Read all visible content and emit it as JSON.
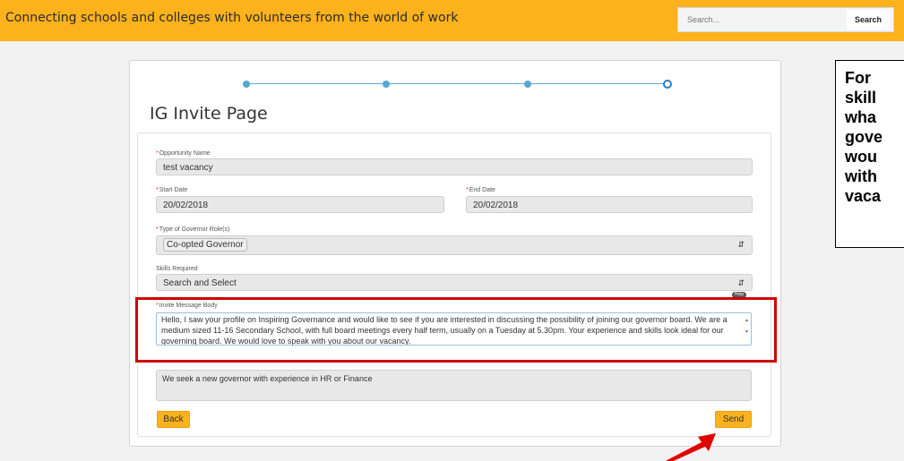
{
  "header": {
    "tagline": "Connecting schools and colleges with volunteers from the world of work",
    "search_placeholder": "Search...",
    "search_button": "Search"
  },
  "progress": {
    "total_steps": 4,
    "current_step": 4
  },
  "page": {
    "title": "IG Invite Page"
  },
  "form": {
    "required_marker": "*",
    "opportunity_name": {
      "label": "Opportunity Name",
      "value": "test vacancy"
    },
    "start_date": {
      "label": "Start Date",
      "value": "20/02/2018"
    },
    "end_date": {
      "label": "End Date",
      "value": "20/02/2018"
    },
    "governor_role": {
      "label": "Type of Governor Role(s)",
      "selected": "Co-opted Governor"
    },
    "skills": {
      "label": "Skills Required",
      "placeholder": "Search and Select"
    },
    "invite_message": {
      "label": "Invite Message Body",
      "help_badge": "Help",
      "value": "Hello, I saw your profile on Inspiring Governance and would like to see if you are interested in discussing the possibility of joining our governor board. We are a medium sized 11-16 Secondary School, with full board meetings every half term, usually on a Tuesday at 5.30pm. Your experience and skills look ideal for our governing board. We would love to speak with you about our vacancy."
    },
    "opportunity_description": {
      "value": "We seek a new governor with experience in HR or Finance"
    },
    "back_button": "Back",
    "send_button": "Send"
  },
  "annotation": {
    "note_text": "For\nskill\nwha\ngove\nwou\nwith\nvaca",
    "highlight_color": "#d00000",
    "arrow_color": "#e00000"
  },
  "colors": {
    "brand": "#fbb21d",
    "progress": "#5aa6d6"
  }
}
